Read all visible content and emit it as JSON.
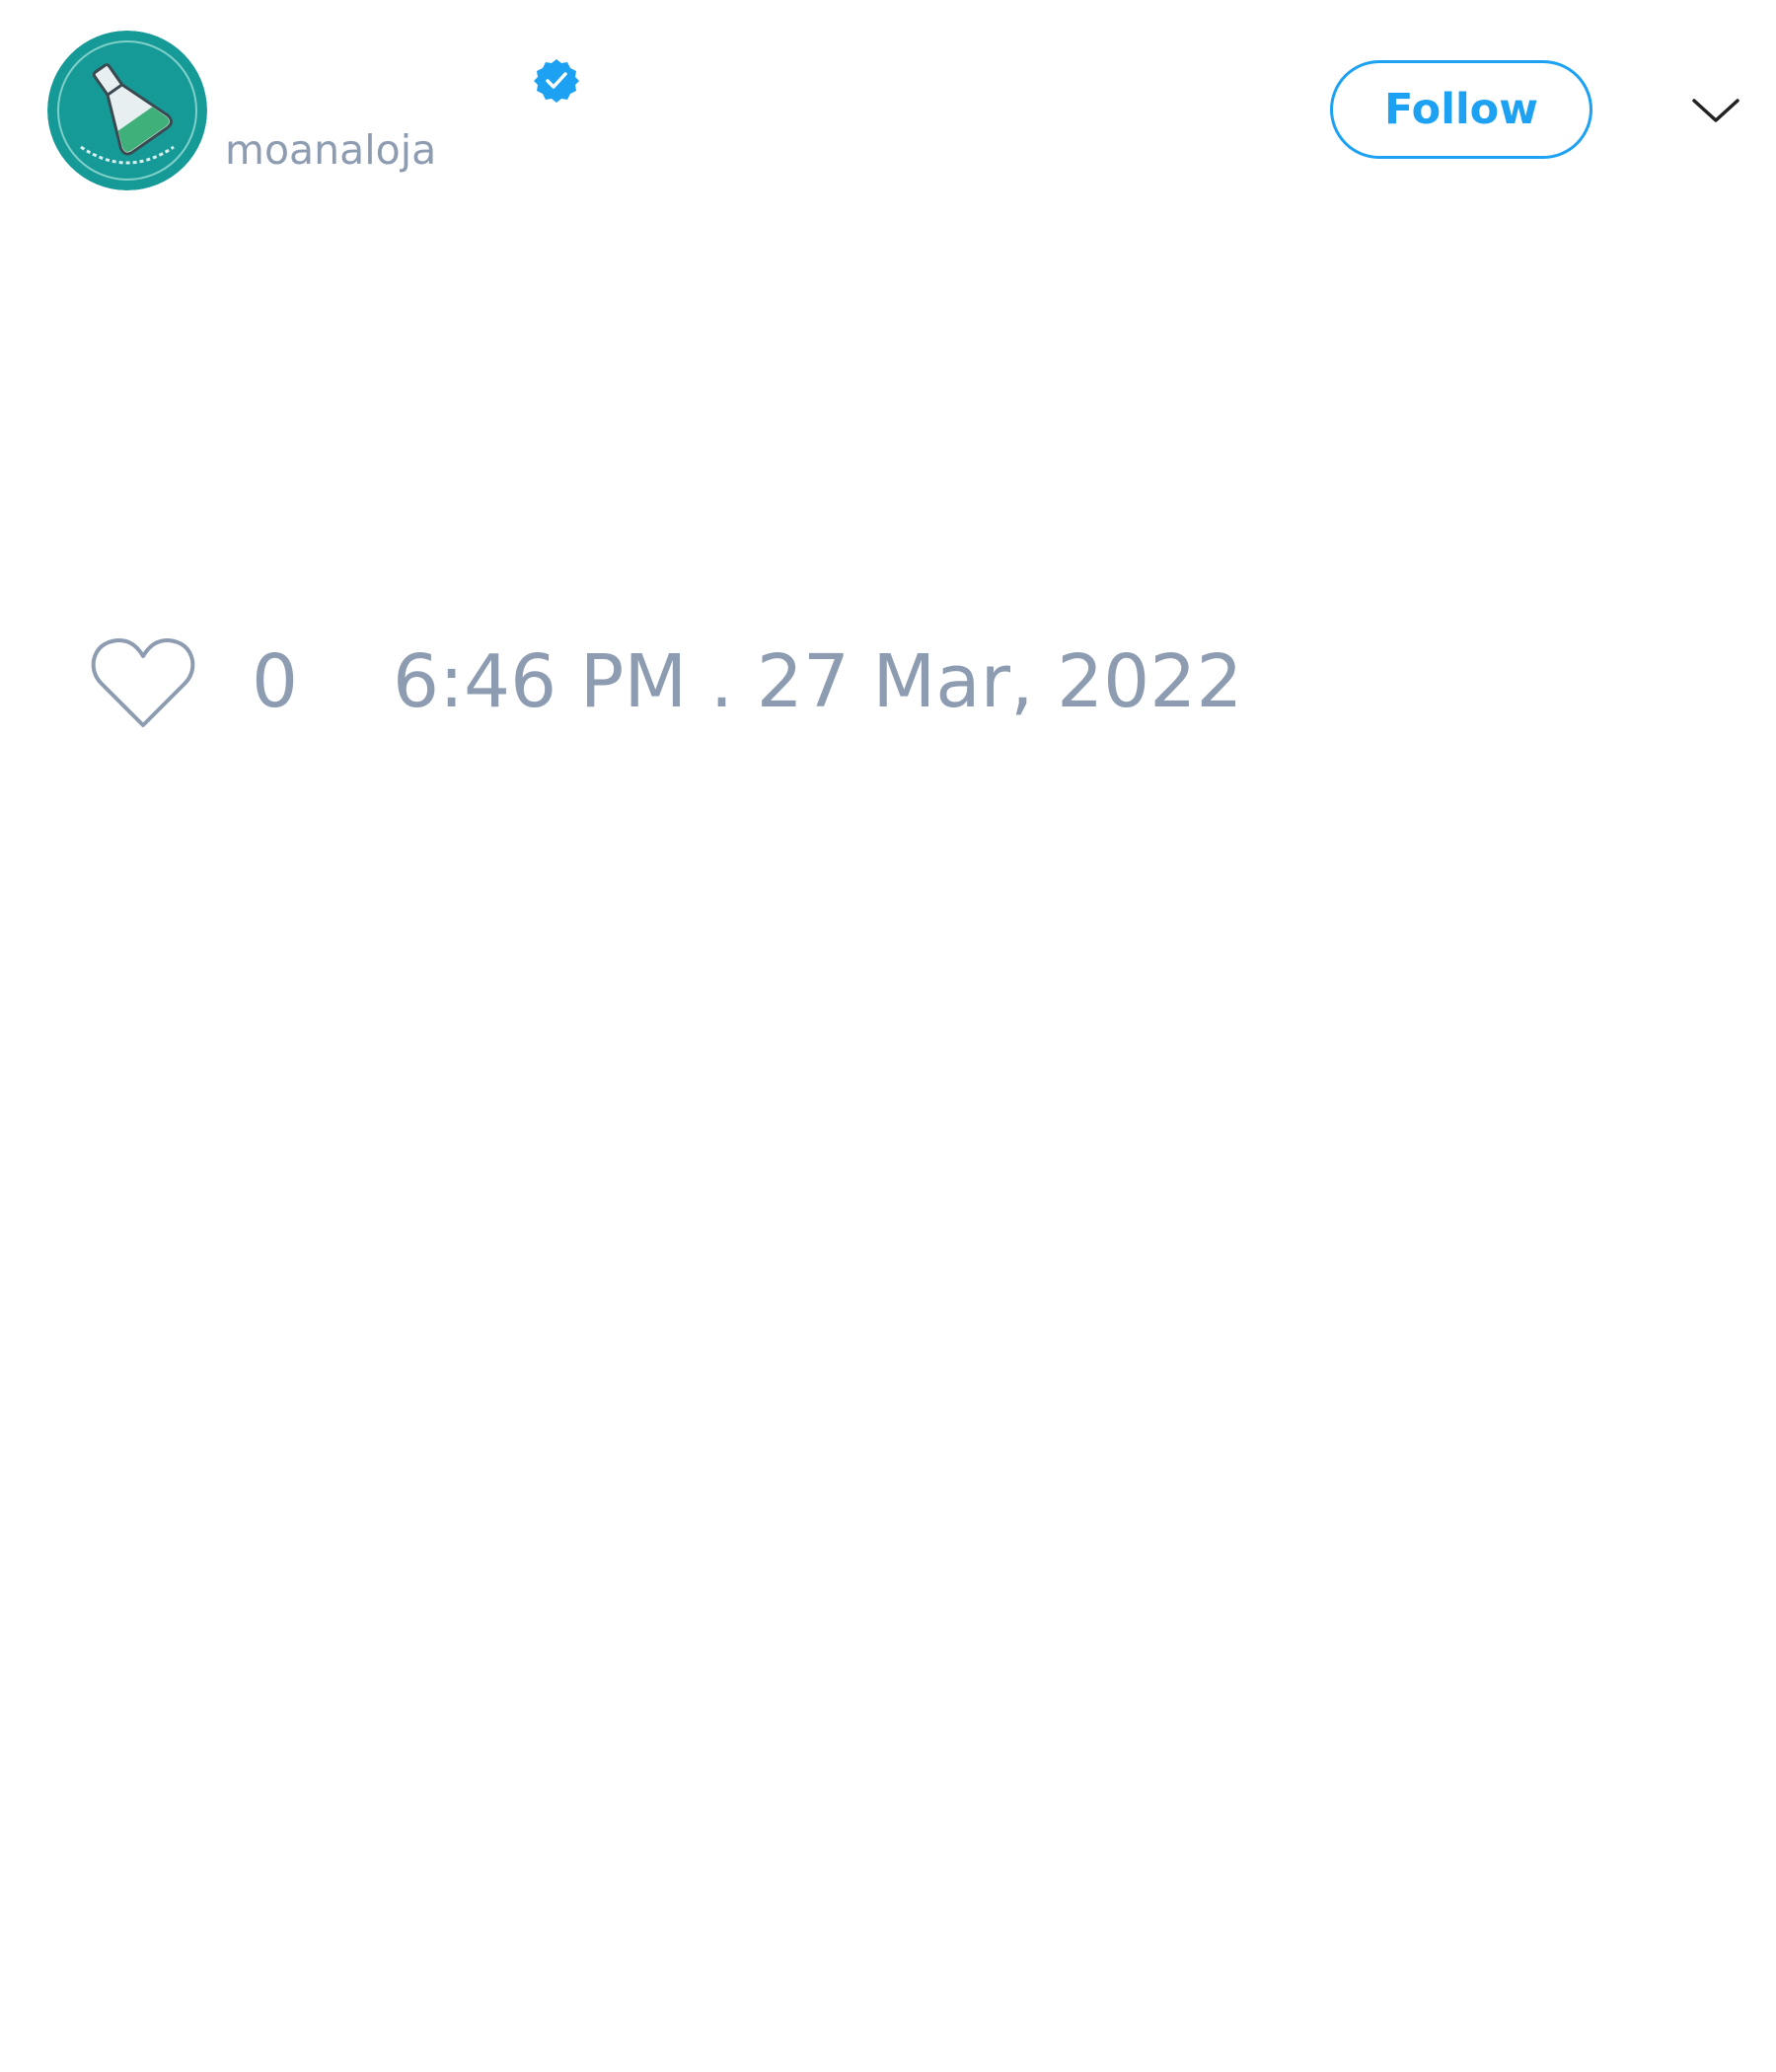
{
  "tweet": {
    "author": {
      "handle": "moanaloja",
      "verified": true,
      "avatar_icon": "flask-logo-icon"
    },
    "follow_label": "Follow",
    "likes": "0",
    "timestamp": "6:46 PM . 27 Mar, 2022"
  },
  "colors": {
    "accent": "#1da1f2",
    "muted_text": "#8d9cb1",
    "avatar_background": "#169a98",
    "background": "#ffffff"
  },
  "icons": {
    "verified": "verified-badge-icon",
    "more": "chevron-down-icon",
    "like": "heart-icon"
  }
}
